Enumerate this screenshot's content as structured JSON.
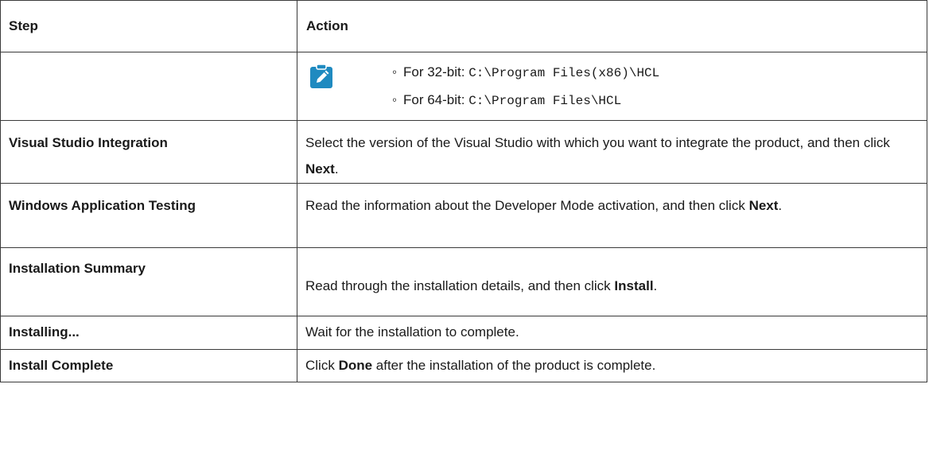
{
  "header": {
    "col_step": "Step",
    "col_action": "Action"
  },
  "note": {
    "icon": "note-pencil-icon",
    "accent": "#1f8ac0",
    "items": [
      {
        "prefix": "For 32-bit: ",
        "path": "C:\\Program Files(x86)\\HCL"
      },
      {
        "prefix": "For 64-bit: ",
        "path": "C:\\Program Files\\HCL"
      }
    ]
  },
  "rows": [
    {
      "step": "Visual Studio Integration",
      "action_pre": "Select the version of the Visual Studio with which you want to integrate the product, and then click ",
      "action_bold": "Next",
      "action_post": "."
    },
    {
      "step": "Windows Application Testing",
      "action_pre": "Read the information about the Developer Mode activation, and then click ",
      "action_bold": "Next",
      "action_post": "."
    },
    {
      "step": "Installation Summary",
      "action_pre": "Read through the installation details, and then click ",
      "action_bold": "Install",
      "action_post": "."
    },
    {
      "step": "Installing...",
      "action_pre": "Wait for the installation to complete.",
      "action_bold": "",
      "action_post": ""
    },
    {
      "step": "Install Complete",
      "action_pre": "Click ",
      "action_bold": "Done",
      "action_post": " after the installation of the product is complete."
    }
  ]
}
